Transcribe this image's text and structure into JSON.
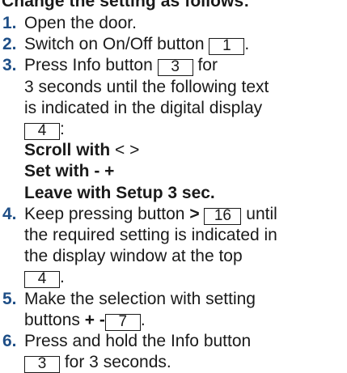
{
  "heading": "Change the setting as follows:",
  "steps": [
    {
      "num": "1.",
      "text": "Open the door."
    },
    {
      "num": "2.",
      "text": "Switch on On/Off button",
      "ref": "1",
      "after": "."
    },
    {
      "num": "3.",
      "line1": "Press Info button",
      "ref": "3",
      "line1_after": "for",
      "line2": "3 seconds until the following text",
      "line3": "is indicated in the digital display",
      "ref2": "4",
      "ref2_after": ":",
      "bold1_a": "Scroll with",
      "bold1_b": "< >",
      "bold2": "Set with - +",
      "bold3": "Leave with Setup 3 sec."
    },
    {
      "num": "4.",
      "line1": "Keep pressing button",
      "key": ">",
      "ref": "16",
      "line1_after": "until",
      "line2": "the required setting is indicated in",
      "line3": "the display window at the top",
      "ref2": "4",
      "ref2_after": "."
    },
    {
      "num": "5.",
      "line1": "Make the selection with setting",
      "line2": "buttons",
      "keys": "+ -",
      "ref": "7",
      "after": "."
    },
    {
      "num": "6.",
      "line1": "Press and hold the Info button",
      "ref": "3",
      "line2_after": "for 3 seconds."
    }
  ]
}
